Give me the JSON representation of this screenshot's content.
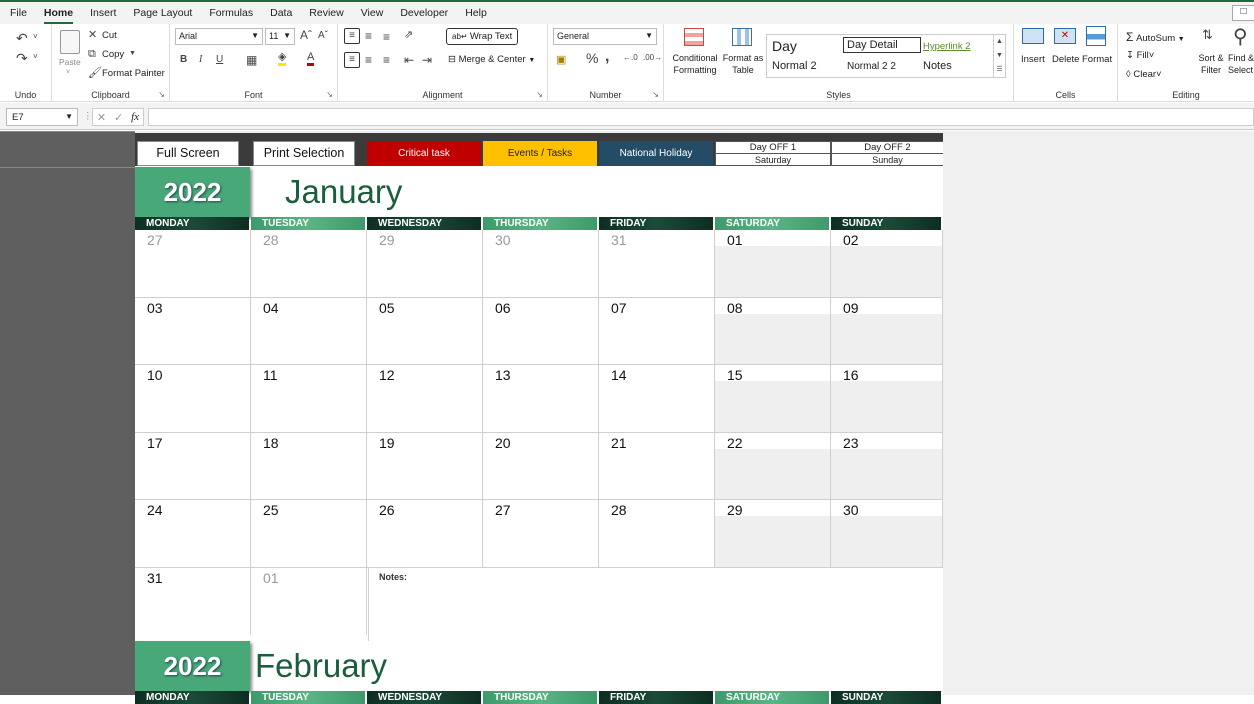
{
  "menu": {
    "tabs": [
      "File",
      "Home",
      "Insert",
      "Page Layout",
      "Formulas",
      "Data",
      "Review",
      "View",
      "Developer",
      "Help"
    ],
    "active": "Home"
  },
  "ribbon": {
    "undo": {
      "label": "Undo"
    },
    "clipboard": {
      "paste": "Paste",
      "cut": "Cut",
      "copy": "Copy",
      "format_painter": "Format Painter",
      "label": "Clipboard"
    },
    "font": {
      "name": "Arial",
      "size": "11",
      "bold": "B",
      "italic": "I",
      "underline": "U",
      "label": "Font"
    },
    "alignment": {
      "wrap_text": "Wrap Text",
      "merge_center": "Merge & Center",
      "label": "Alignment"
    },
    "number": {
      "format": "General",
      "percent": "%",
      "comma": ",",
      "label": "Number"
    },
    "styles": {
      "conditional_formatting": "Conditional Formatting",
      "format_as_table": "Format as Table",
      "gallery": [
        "Day",
        "Day Detail",
        "Hyperlink 2",
        "Normal 2",
        "Normal 2 2",
        "Notes"
      ],
      "label": "Styles"
    },
    "cells": {
      "insert": "Insert",
      "delete": "Delete",
      "format": "Format",
      "label": "Cells"
    },
    "editing": {
      "autosum": "AutoSum",
      "fill": "Fill",
      "clear": "Clear",
      "sort_filter": "Sort & Filter",
      "find_select": "Find & Select",
      "label": "Editing"
    }
  },
  "formula_bar": {
    "name_box": "E7",
    "formula": ""
  },
  "calendar": {
    "buttons": {
      "full_screen": "Full Screen",
      "print_selection": "Print Selection"
    },
    "legend": [
      {
        "label": "Critical task",
        "color": "#c00000"
      },
      {
        "label": "Events / Tasks",
        "color": "#ffc000"
      },
      {
        "label": "National Holiday",
        "color": "#244c66"
      }
    ],
    "day_off": [
      {
        "title": "Day OFF 1",
        "day": "Saturday"
      },
      {
        "title": "Day OFF 2",
        "day": "Sunday"
      }
    ],
    "year": "2022",
    "month": "January",
    "next_month": "February",
    "weekdays": [
      "MONDAY",
      "TUESDAY",
      "WEDNESDAY",
      "THURSDAY",
      "FRIDAY",
      "SATURDAY",
      "SUNDAY"
    ],
    "weeks": [
      [
        "27",
        "28",
        "29",
        "30",
        "31",
        "01",
        "02"
      ],
      [
        "03",
        "04",
        "05",
        "06",
        "07",
        "08",
        "09"
      ],
      [
        "10",
        "11",
        "12",
        "13",
        "14",
        "15",
        "16"
      ],
      [
        "17",
        "18",
        "19",
        "20",
        "21",
        "22",
        "23"
      ],
      [
        "24",
        "25",
        "26",
        "27",
        "28",
        "29",
        "30"
      ],
      [
        "31",
        "01"
      ]
    ],
    "other_month_cells": [
      [
        0,
        0
      ],
      [
        0,
        1
      ],
      [
        0,
        2
      ],
      [
        0,
        3
      ],
      [
        0,
        4
      ],
      [
        5,
        1
      ]
    ],
    "notes_label": "Notes:",
    "accent_green": "#48a877",
    "dark_green": "#0d2e22"
  }
}
